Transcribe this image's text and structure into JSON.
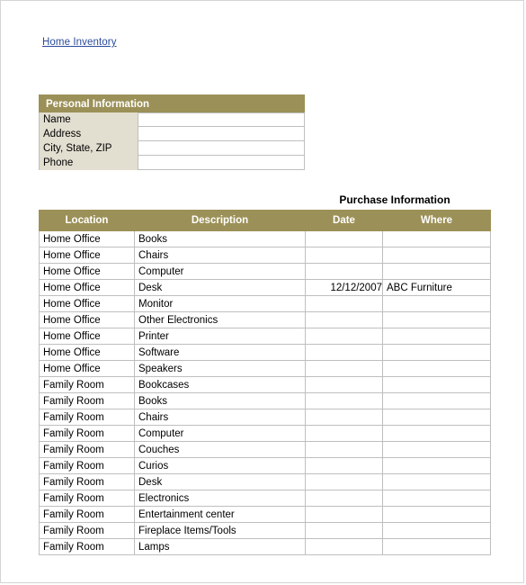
{
  "document": {
    "title_link": "Home Inventory"
  },
  "personal_information": {
    "header": "Personal Information",
    "fields": [
      {
        "label": "Name",
        "value": ""
      },
      {
        "label": "Address",
        "value": ""
      },
      {
        "label": "City, State, ZIP",
        "value": ""
      },
      {
        "label": "Phone",
        "value": ""
      }
    ]
  },
  "inventory": {
    "group_header": "Purchase Information",
    "columns": [
      "Location",
      "Description",
      "Date",
      "Where"
    ],
    "rows": [
      {
        "location": "Home Office",
        "description": "Books",
        "date": "",
        "where": ""
      },
      {
        "location": "Home Office",
        "description": "Chairs",
        "date": "",
        "where": ""
      },
      {
        "location": "Home Office",
        "description": "Computer",
        "date": "",
        "where": ""
      },
      {
        "location": "Home Office",
        "description": "Desk",
        "date": "12/12/2007",
        "where": "ABC Furniture"
      },
      {
        "location": "Home Office",
        "description": "Monitor",
        "date": "",
        "where": ""
      },
      {
        "location": "Home Office",
        "description": "Other Electronics",
        "date": "",
        "where": ""
      },
      {
        "location": "Home Office",
        "description": "Printer",
        "date": "",
        "where": ""
      },
      {
        "location": "Home Office",
        "description": "Software",
        "date": "",
        "where": ""
      },
      {
        "location": "Home Office",
        "description": "Speakers",
        "date": "",
        "where": ""
      },
      {
        "location": "Family Room",
        "description": "Bookcases",
        "date": "",
        "where": ""
      },
      {
        "location": "Family Room",
        "description": "Books",
        "date": "",
        "where": ""
      },
      {
        "location": "Family Room",
        "description": "Chairs",
        "date": "",
        "where": ""
      },
      {
        "location": "Family Room",
        "description": "Computer",
        "date": "",
        "where": ""
      },
      {
        "location": "Family Room",
        "description": "Couches",
        "date": "",
        "where": ""
      },
      {
        "location": "Family Room",
        "description": "Curios",
        "date": "",
        "where": ""
      },
      {
        "location": "Family Room",
        "description": "Desk",
        "date": "",
        "where": ""
      },
      {
        "location": "Family Room",
        "description": "Electronics",
        "date": "",
        "where": ""
      },
      {
        "location": "Family Room",
        "description": "Entertainment center",
        "date": "",
        "where": ""
      },
      {
        "location": "Family Room",
        "description": "Fireplace Items/Tools",
        "date": "",
        "where": ""
      },
      {
        "location": "Family Room",
        "description": "Lamps",
        "date": "",
        "where": ""
      }
    ]
  },
  "colors": {
    "header_band": "#9b9057",
    "label_cell": "#e2ded0",
    "link_text": "#2b4c9b",
    "grid_line": "#bfbfbf",
    "page_border": "#d4d4d4"
  }
}
